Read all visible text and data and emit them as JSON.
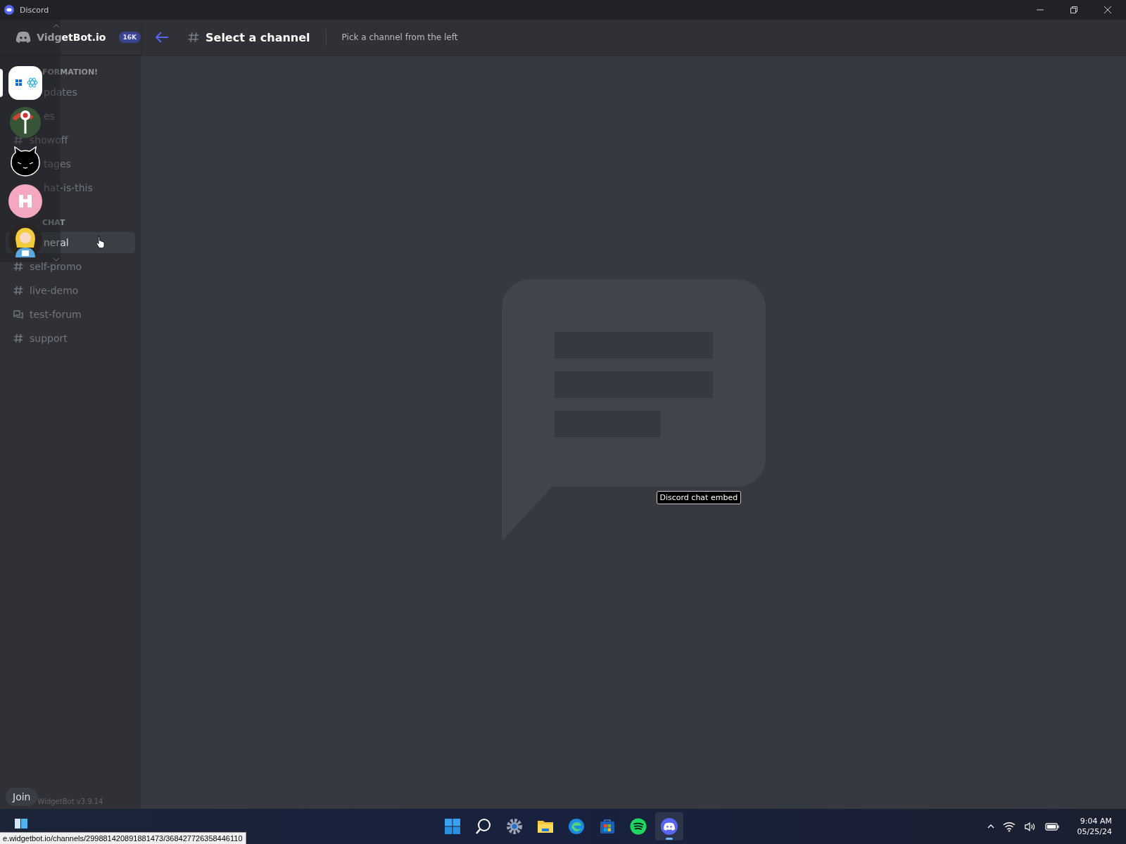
{
  "window": {
    "title": "Discord"
  },
  "server": {
    "name": "VidgetBot.io",
    "badge": "16K"
  },
  "servers": [
    {
      "kind": "apps",
      "selected": true
    },
    {
      "kind": "key",
      "selected": false
    },
    {
      "kind": "cat",
      "selected": false
    },
    {
      "kind": "pink",
      "selected": false
    },
    {
      "kind": "figure",
      "selected": false
    }
  ],
  "channels": [
    {
      "kind": "category",
      "name": "FORMATION!"
    },
    {
      "kind": "partial",
      "name": "pdates",
      "selected": false
    },
    {
      "kind": "partial",
      "name": "es",
      "selected": false
    },
    {
      "kind": "hash",
      "name": "showoff",
      "selected": false
    },
    {
      "kind": "partial",
      "name": "tages",
      "selected": false
    },
    {
      "kind": "partial",
      "name": "hat-is-this",
      "selected": false
    },
    {
      "kind": "category",
      "name": "CHAT"
    },
    {
      "kind": "partial",
      "name": "neral",
      "selected": true
    },
    {
      "kind": "hash",
      "name": "self-promo",
      "selected": false
    },
    {
      "kind": "hash",
      "name": "live-demo",
      "selected": false
    },
    {
      "kind": "forum",
      "name": "test-forum",
      "selected": false
    },
    {
      "kind": "hash",
      "name": "support",
      "selected": false
    }
  ],
  "header": {
    "title": "Select a channel",
    "subtitle": "Pick a channel from the left"
  },
  "tooltip": "Discord chat embed",
  "join_button": "Join",
  "version": "WidgetBot v3.9.14",
  "status_url": "e.widgetbot.io/channels/299881420891881473/368427726358446110",
  "taskbar": {
    "apps": [
      {
        "kind": "start",
        "selected": false
      },
      {
        "kind": "search",
        "selected": false
      },
      {
        "kind": "settings",
        "selected": false
      },
      {
        "kind": "files",
        "selected": false
      },
      {
        "kind": "browser",
        "selected": false
      },
      {
        "kind": "store",
        "selected": false
      },
      {
        "kind": "music",
        "selected": false
      },
      {
        "kind": "chat",
        "selected": true
      }
    ]
  },
  "clock": {
    "time": "9:04 AM",
    "date": "05/25/24"
  }
}
